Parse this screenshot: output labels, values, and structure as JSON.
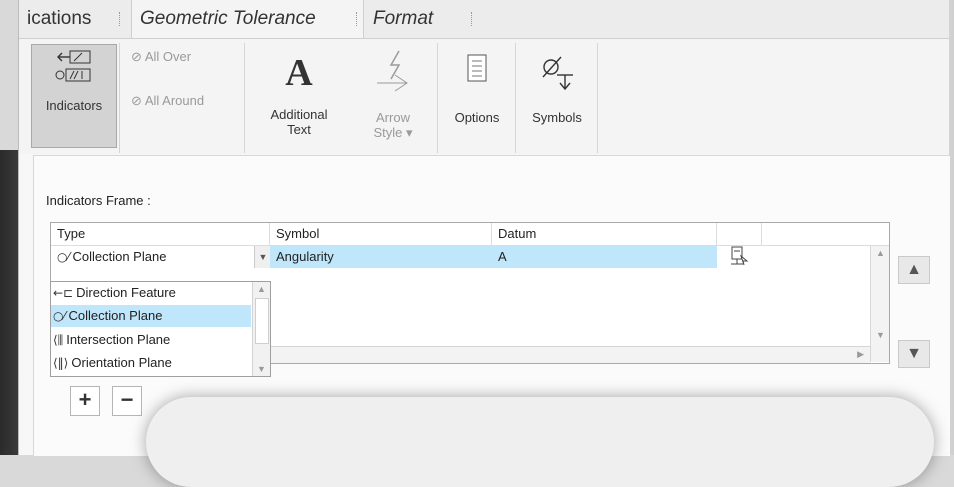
{
  "tabs": [
    {
      "label": "ications"
    },
    {
      "label": "Geometric Tolerance"
    },
    {
      "label": "Format"
    }
  ],
  "ribbon": {
    "indicators": {
      "label": "Indicators",
      "icon": "indicators-icon"
    },
    "all_over": {
      "label": "All Over",
      "icon": "all-over-icon"
    },
    "all_around": {
      "label": "All Around",
      "icon": "all-around-icon"
    },
    "additional_text": {
      "line1": "Additional",
      "line2": "Text",
      "glyph": "A"
    },
    "arrow_style": {
      "line1": "Arrow",
      "line2": "Style ▾"
    },
    "options": {
      "label": "Options"
    },
    "symbols": {
      "label": "Symbols"
    }
  },
  "panel": {
    "frame_label": "Indicators Frame :",
    "columns": [
      "Type",
      "Symbol",
      "Datum"
    ],
    "row": {
      "type": "Collection Plane",
      "symbol": "Angularity",
      "datum": "A"
    },
    "type_options": [
      "Direction Feature",
      "Collection Plane",
      "Intersection Plane",
      "Orientation Plane"
    ],
    "selected_option_index": 1
  },
  "buttons": {
    "add": "+",
    "remove": "−",
    "up": "▲",
    "down": "▼"
  }
}
